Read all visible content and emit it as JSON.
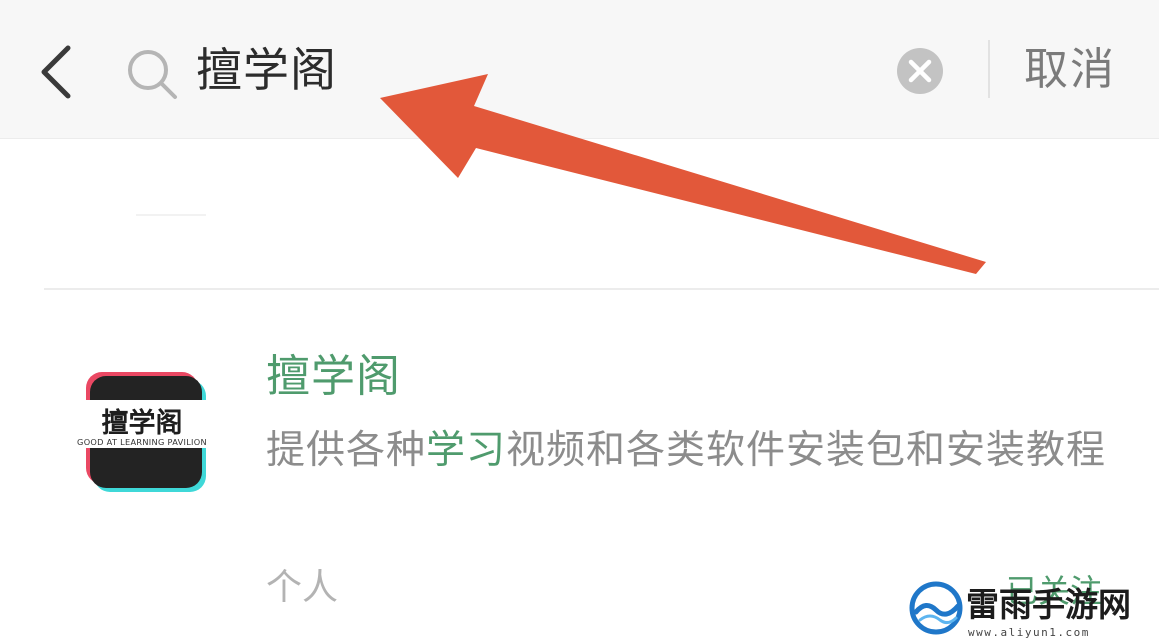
{
  "search": {
    "query": "擅学阁",
    "cancel_label": "取消"
  },
  "result": {
    "name": "擅学阁",
    "avatar_title": "擅学阁",
    "avatar_subtitle": "GOOD AT LEARNING PAVILION",
    "description_before": "提供各种",
    "description_highlight": "学习",
    "description_after": "视频和各类软件安装包和安装教程",
    "type": "个人",
    "follow_label": "已关注"
  },
  "watermark": {
    "brand": "雷雨手游网",
    "url": "www.aliyun1.com"
  },
  "colors": {
    "header_bg": "#f7f7f7",
    "highlight_green": "#4f9b6d",
    "arrow_red": "#e2583a"
  },
  "icons": {
    "back": "chevron-left-icon",
    "search": "search-icon",
    "clear": "clear-circle-icon",
    "arrow": "annotation-arrow-icon"
  }
}
